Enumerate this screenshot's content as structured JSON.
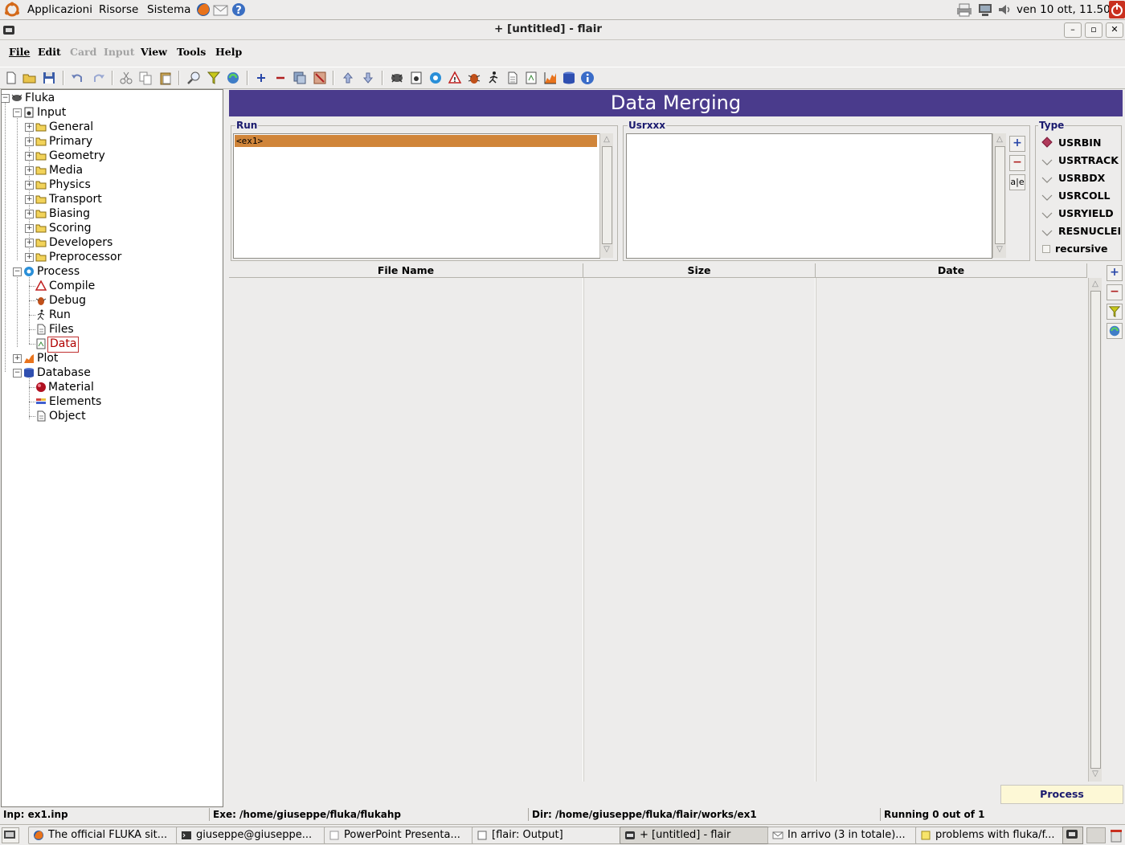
{
  "top_panel": {
    "menus": [
      "Applicazioni",
      "Risorse",
      "Sistema"
    ],
    "clock": "ven 10 ott, 11.50"
  },
  "window": {
    "title": "+ [untitled] - flair"
  },
  "menubar": {
    "items": [
      {
        "label": "File",
        "enabled": true
      },
      {
        "label": "Edit",
        "enabled": true
      },
      {
        "label": "Card",
        "enabled": false
      },
      {
        "label": "Input",
        "enabled": false
      },
      {
        "label": "View",
        "enabled": true
      },
      {
        "label": "Tools",
        "enabled": true
      },
      {
        "label": "Help",
        "enabled": true
      }
    ]
  },
  "toolbar": {
    "icons": [
      "new-icon",
      "open-icon",
      "save-icon",
      "undo-icon",
      "redo-icon",
      "cut-icon",
      "copy-icon",
      "paste-icon",
      "find-icon",
      "filter-icon",
      "refresh-icon",
      "add-icon",
      "remove-icon",
      "clone-icon",
      "disable-icon",
      "move-up-icon",
      "move-down-icon",
      "fluka-icon",
      "input-icon",
      "process-icon",
      "compile-icon",
      "debug-icon",
      "run-icon",
      "files-icon",
      "data-icon",
      "plot-icon",
      "database-icon",
      "info-icon"
    ]
  },
  "tree": {
    "root": "Fluka",
    "input": "Input",
    "input_children": [
      "General",
      "Primary",
      "Geometry",
      "Media",
      "Physics",
      "Transport",
      "Biasing",
      "Scoring",
      "Developers",
      "Preprocessor"
    ],
    "process": "Process",
    "process_children": [
      "Compile",
      "Debug",
      "Run",
      "Files",
      "Data"
    ],
    "selected": "Data",
    "plot": "Plot",
    "database": "Database",
    "database_children": [
      "Material",
      "Elements",
      "Object"
    ]
  },
  "panel": {
    "header": "Data Merging",
    "run_label": "Run",
    "run_items": [
      "<ex1>"
    ],
    "usr_label": "Usrxxx",
    "usr_items": [],
    "type_label": "Type",
    "types": [
      "USRBIN",
      "USRTRACK",
      "USRBDX",
      "USRCOLL",
      "USRYIELD",
      "RESNUCLEI"
    ],
    "selected_type": "USRBIN",
    "recursive_label": "recursive",
    "recursive_checked": false,
    "edit_button": "a|e"
  },
  "file_table": {
    "columns": [
      "File Name",
      "Size",
      "Date"
    ],
    "rows": []
  },
  "process_button": "Process",
  "statusbar": {
    "inp": "Inp: ex1.inp",
    "exe": "Exe: /home/giuseppe/fluka/flukahp",
    "dir": "Dir: /home/giuseppe/fluka/flair/works/ex1",
    "running": "Running 0 out of 1"
  },
  "taskbar": {
    "tasks": [
      {
        "label": "The official FLUKA sit...",
        "active": false
      },
      {
        "label": "giuseppe@giuseppe...",
        "active": false
      },
      {
        "label": "PowerPoint Presenta...",
        "active": false
      },
      {
        "label": "[flair: Output]",
        "active": false
      },
      {
        "label": "+ [untitled] - flair",
        "active": true
      },
      {
        "label": "In arrivo (3 in totale)...",
        "active": false
      },
      {
        "label": "problems with fluka/f...",
        "active": false
      }
    ]
  }
}
